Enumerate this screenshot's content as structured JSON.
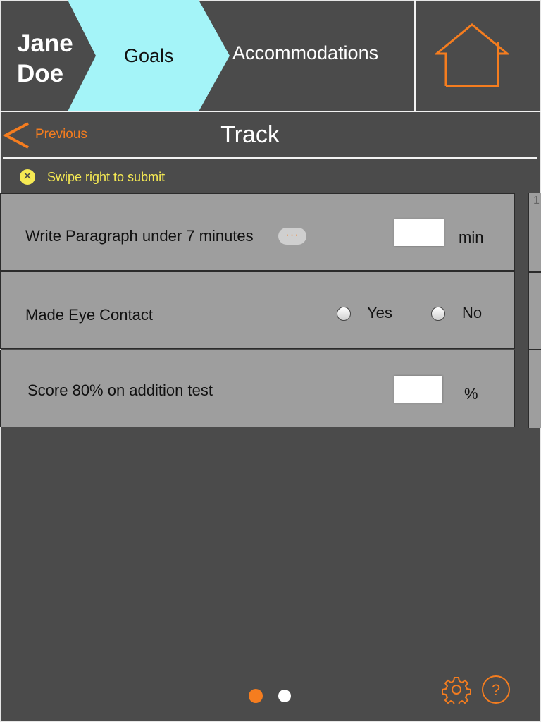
{
  "header": {
    "student_first": "Jane",
    "student_last": "Doe",
    "tabs": [
      {
        "label": "Goals",
        "active": true
      },
      {
        "label": "Accommodations",
        "active": false
      }
    ],
    "home_icon": "home-icon"
  },
  "nav": {
    "previous_label": "Previous",
    "title": "Track"
  },
  "notice": {
    "icon": "close-circle-icon",
    "text": "Swipe right to submit"
  },
  "goals": [
    {
      "label": "Write Paragraph under 7 minutes",
      "input_value": "",
      "unit": "min",
      "more": "···"
    },
    {
      "label": "Made Eye Contact",
      "options": [
        "Yes",
        "No"
      ],
      "selected": null
    },
    {
      "label": "Score 80% on addition test",
      "input_value": "",
      "unit": "%"
    }
  ],
  "next_card_peek": "1",
  "footer": {
    "page_dots": 2,
    "current_page": 1,
    "settings_icon": "gear-icon",
    "help_icon": "help-icon"
  },
  "colors": {
    "background": "#4b4b4b",
    "active_tab": "#a4f4f8",
    "accent": "#f57d1f",
    "notice": "#f6ea53",
    "card": "#9e9e9e"
  }
}
